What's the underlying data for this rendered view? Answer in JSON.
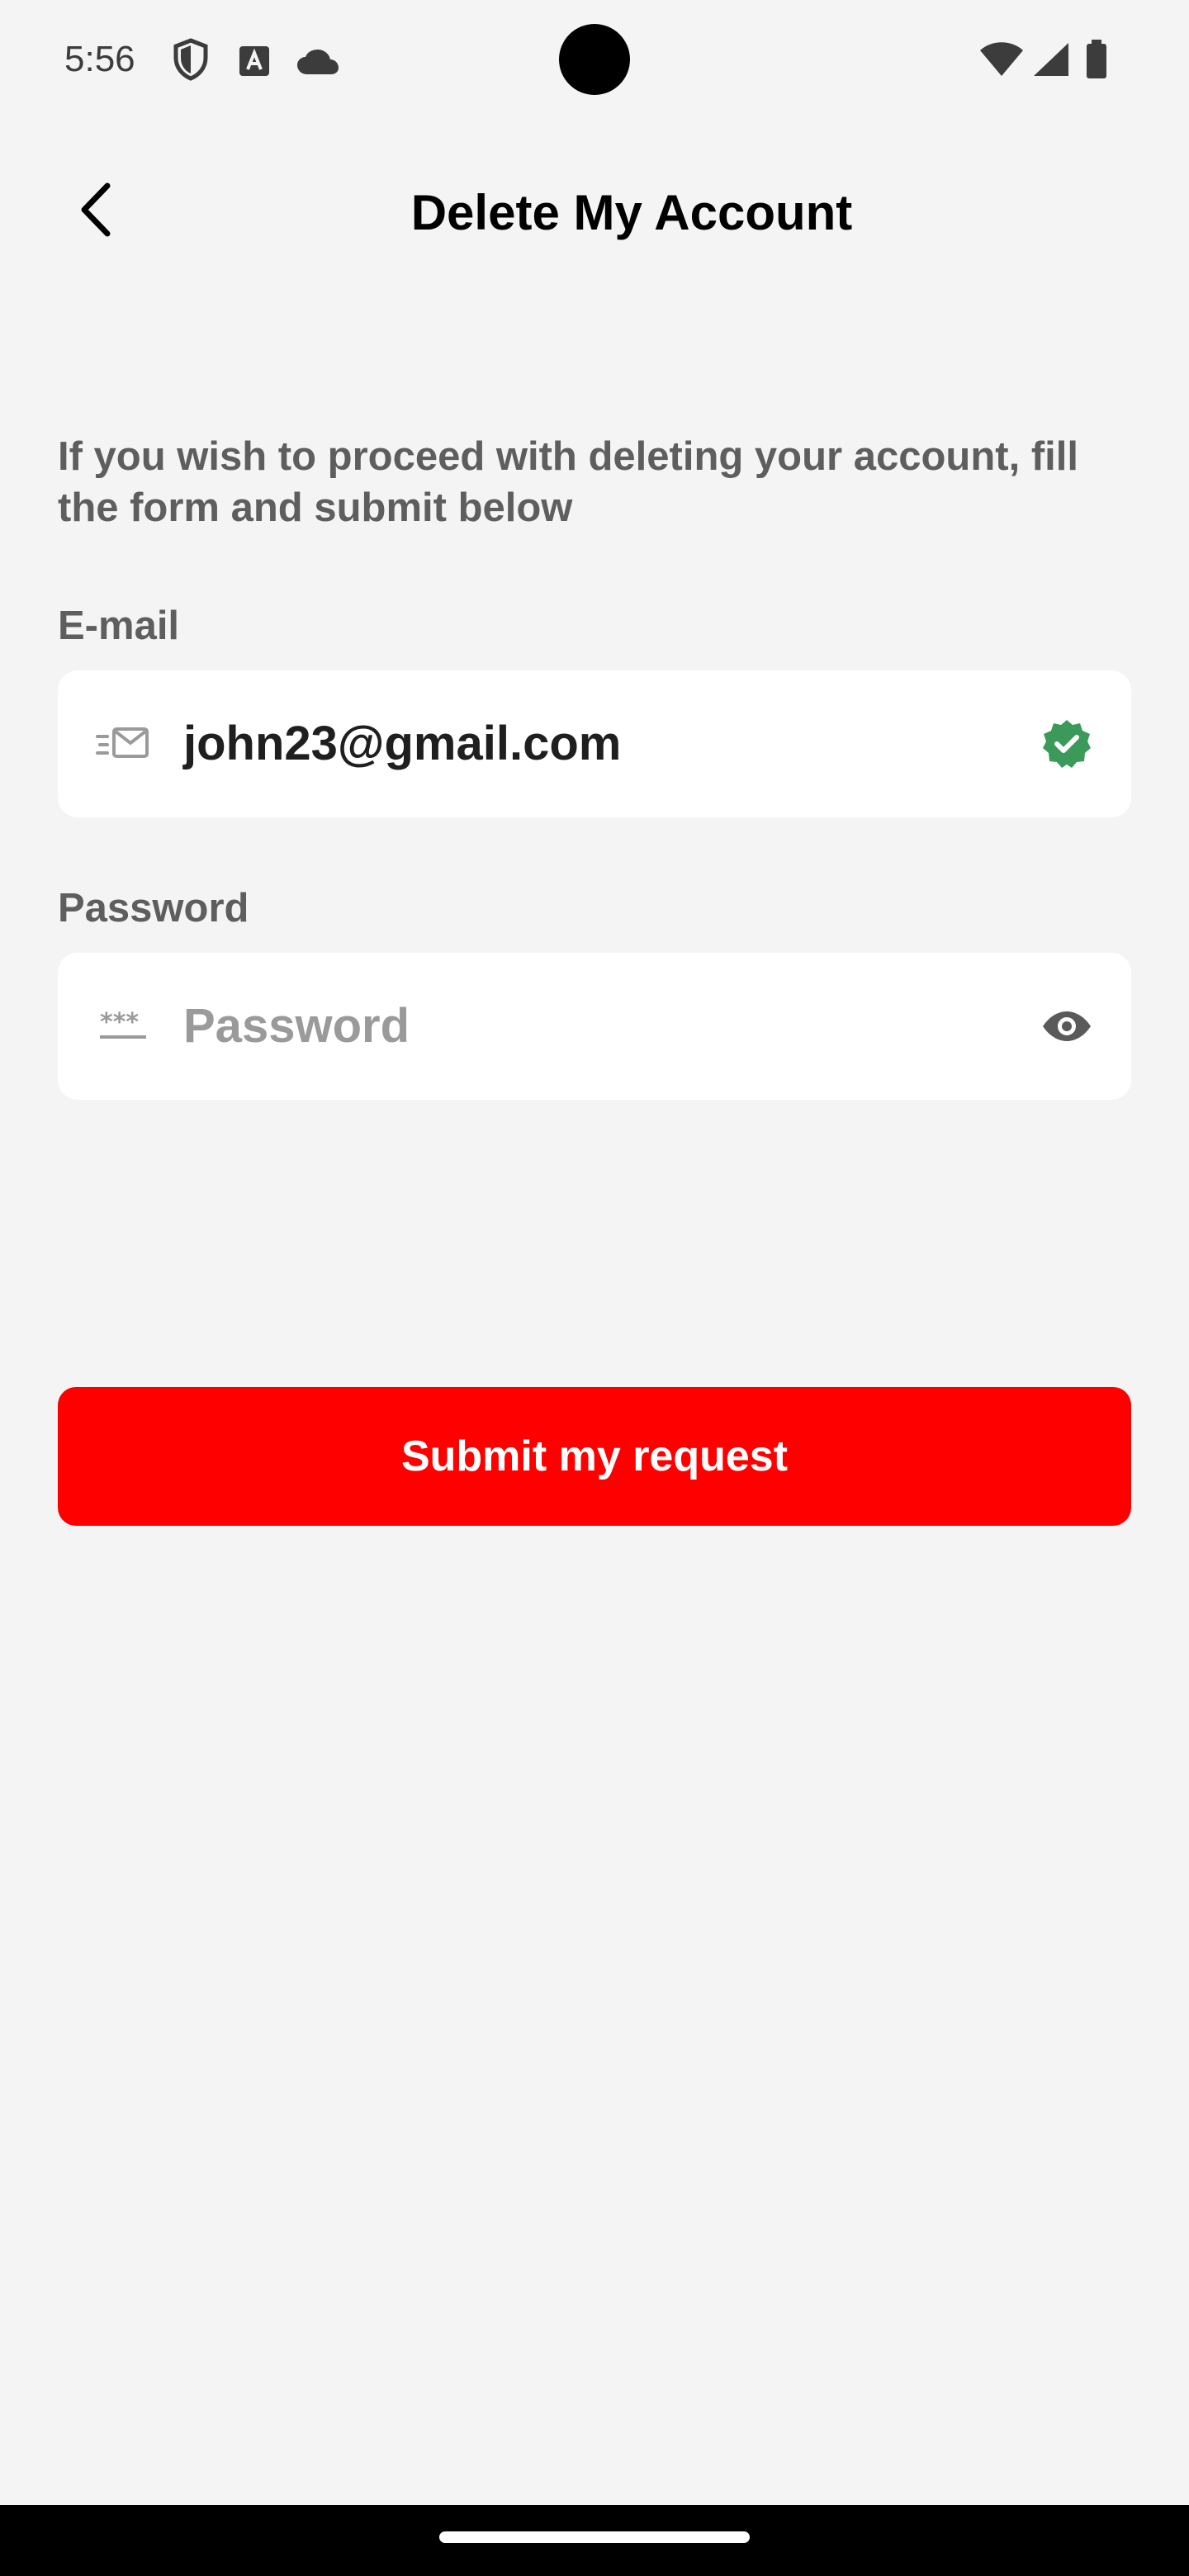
{
  "status_bar": {
    "time": "5:56",
    "left_icons": [
      "shield-icon",
      "font-download-icon",
      "cloud-icon"
    ],
    "right_icons": [
      "wifi-icon",
      "cell-signal-icon",
      "battery-icon"
    ]
  },
  "header": {
    "title": "Delete My Account",
    "back_icon": "chevron-left-icon"
  },
  "form": {
    "intro": "If you wish to proceed with deleting your account, fill the form and submit below",
    "email": {
      "label": "E-mail",
      "value": "john23@gmail.com",
      "leading_icon": "mail-icon",
      "trailing_icon": "verified-check-icon",
      "verified_color": "#3b9a5a"
    },
    "password": {
      "label": "Password",
      "placeholder": "Password",
      "value": "",
      "leading_icon": "password-dots-icon",
      "trailing_icon": "eye-icon"
    },
    "submit_label": "Submit my request"
  },
  "colors": {
    "background": "#f4f4f4",
    "primary": "#ff0000",
    "field_bg": "#ffffff",
    "label": "#5e5e5e"
  }
}
